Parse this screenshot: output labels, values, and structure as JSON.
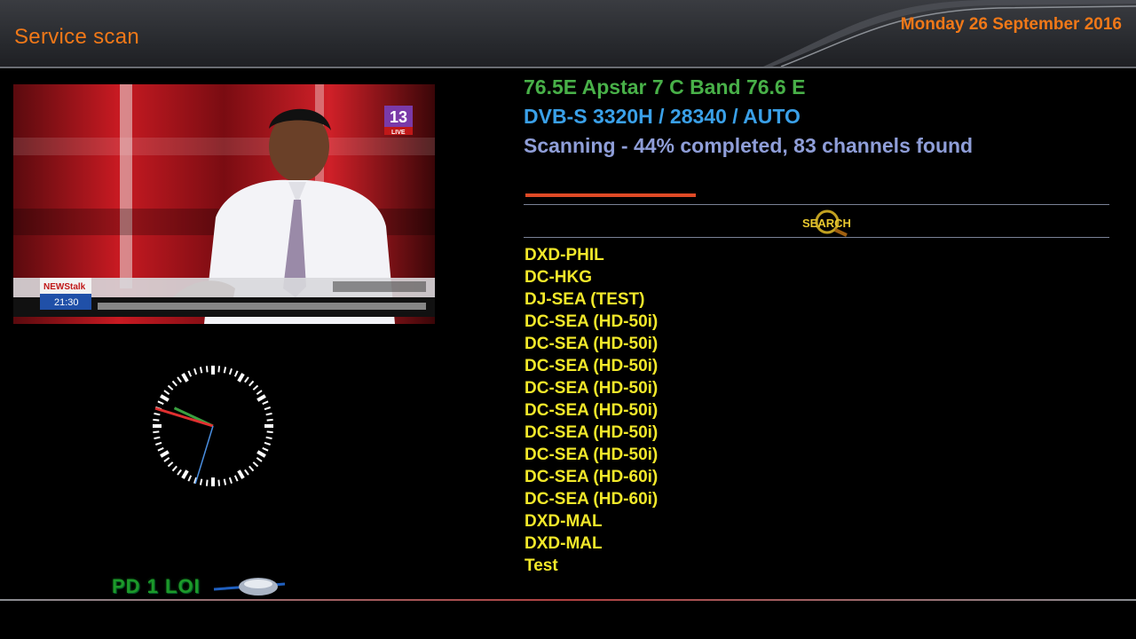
{
  "header": {
    "title": "Service scan",
    "date": "Monday 26 September 2016"
  },
  "video": {
    "channel_badge": "13",
    "live_badge": "LIVE",
    "program_logo": "NEWStalk",
    "time_display": "21:30"
  },
  "clock": {
    "hour_hand_deg": 295,
    "minute_hand_deg": 287,
    "second_hand_deg": 197
  },
  "logo_text": "PD 1 LOI",
  "scan": {
    "satellite": "76.5E Apstar 7 C Band 76.6 E",
    "transponder": "DVB-S 3320H / 28340 / AUTO",
    "status": "Scanning - 44% completed, 83 channels found",
    "progress_percent": 44,
    "search_label": "SEARCH"
  },
  "channels": [
    "DXD-PHIL",
    "DC-HKG",
    "DJ-SEA (TEST)",
    "DC-SEA (HD-50i)",
    "DC-SEA (HD-50i)",
    "DC-SEA (HD-50i)",
    "DC-SEA (HD-50i)",
    "DC-SEA (HD-50i)",
    "DC-SEA (HD-50i)",
    "DC-SEA (HD-50i)",
    "DC-SEA (HD-60i)",
    "DC-SEA (HD-60i)",
    "DXD-MAL",
    "DXD-MAL",
    "Test"
  ],
  "colors": {
    "accent_orange": "#f07818",
    "satellite_green": "#48b048",
    "transponder_blue": "#3aa0e8",
    "status_lavender": "#8f9ed8",
    "channel_yellow": "#f2e82a",
    "progress_red": "#e04a26"
  }
}
